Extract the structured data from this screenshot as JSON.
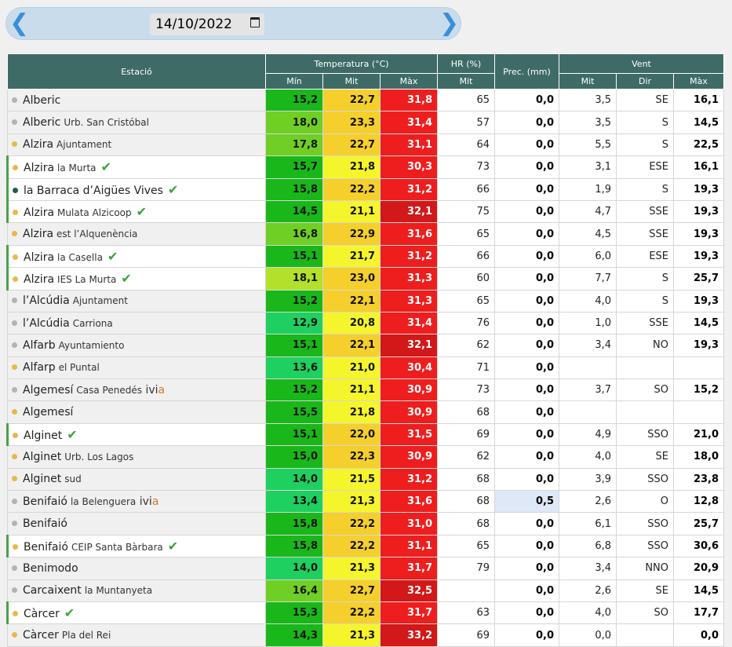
{
  "date": "14/10/2022",
  "header": {
    "estacio": "Estació",
    "temperatura": "Temperatura (°C)",
    "hr": "HR (%)",
    "prec": "Prec. (mm)",
    "vent": "Vent",
    "min": "Mín",
    "mit": "Mit",
    "max": "Màx",
    "hr_mit": "Mit",
    "vent_mit": "Mit",
    "dir": "Dir",
    "vent_max": "Màx"
  },
  "colors": {
    "dot_grey": "#b3b3b3",
    "dot_orange": "#e8b84a",
    "dot_teal": "#1e5b55"
  },
  "rows": [
    {
      "name": "Alberic",
      "sub": "",
      "dot": "grey",
      "check": false,
      "ivia": false,
      "min": "15,2",
      "minc": "#1ab71a",
      "mit": "22,7",
      "mitc": "#f5cf2b",
      "max": "31,8",
      "maxc": "#ee1e1e",
      "hr": "65",
      "prec": "0,0",
      "vmit": "3,5",
      "dir": "SE",
      "vmax": "16,1",
      "white": false
    },
    {
      "name": "Alberic",
      "sub": "Urb. San Cristóbal",
      "dot": "grey",
      "check": false,
      "ivia": false,
      "min": "18,0",
      "minc": "#70cf25",
      "mit": "23,3",
      "mitc": "#f5cf2b",
      "max": "31,4",
      "maxc": "#ee1e1e",
      "hr": "57",
      "prec": "0,0",
      "vmit": "3,5",
      "dir": "S",
      "vmax": "14,5",
      "white": false
    },
    {
      "name": "Alzira",
      "sub": "Ajuntament",
      "dot": "orange",
      "check": false,
      "ivia": false,
      "min": "17,8",
      "minc": "#70cf25",
      "mit": "22,7",
      "mitc": "#f5cf2b",
      "max": "31,1",
      "maxc": "#ee1e1e",
      "hr": "64",
      "prec": "0,0",
      "vmit": "5,5",
      "dir": "S",
      "vmax": "22,5",
      "white": false
    },
    {
      "name": "Alzira",
      "sub": "la Murta",
      "dot": "orange",
      "check": true,
      "ivia": false,
      "min": "15,7",
      "minc": "#1ab71a",
      "mit": "21,8",
      "mitc": "#f5f52b",
      "max": "30,3",
      "maxc": "#ee1e1e",
      "hr": "73",
      "prec": "0,0",
      "vmit": "3,1",
      "dir": "ESE",
      "vmax": "16,1",
      "white": true
    },
    {
      "name": "la Barraca d’Aigües Vives",
      "sub": "",
      "dot": "teal",
      "check": true,
      "ivia": false,
      "min": "15,8",
      "minc": "#1ab71a",
      "mit": "22,2",
      "mitc": "#f5cf2b",
      "max": "31,2",
      "maxc": "#ee1e1e",
      "hr": "66",
      "prec": "0,0",
      "vmit": "1,9",
      "dir": "S",
      "vmax": "19,3",
      "white": true
    },
    {
      "name": "Alzira",
      "sub": "Mulata Alzicoop",
      "dot": "orange",
      "check": true,
      "ivia": false,
      "min": "14,5",
      "minc": "#1ab71a",
      "mit": "21,1",
      "mitc": "#f5f52b",
      "max": "32,1",
      "maxc": "#d21818",
      "hr": "75",
      "prec": "0,0",
      "vmit": "4,7",
      "dir": "SSE",
      "vmax": "19,3",
      "white": true
    },
    {
      "name": "Alzira",
      "sub": "est l’Alquenència",
      "dot": "orange",
      "check": false,
      "ivia": false,
      "min": "16,8",
      "minc": "#70cf25",
      "mit": "22,9",
      "mitc": "#f5cf2b",
      "max": "31,6",
      "maxc": "#ee1e1e",
      "hr": "65",
      "prec": "0,0",
      "vmit": "4,5",
      "dir": "SSE",
      "vmax": "19,3",
      "white": false
    },
    {
      "name": "Alzira",
      "sub": "la Casella",
      "dot": "orange",
      "check": true,
      "ivia": false,
      "min": "15,1",
      "minc": "#1ab71a",
      "mit": "21,7",
      "mitc": "#f5f52b",
      "max": "31,2",
      "maxc": "#ee1e1e",
      "hr": "66",
      "prec": "0,0",
      "vmit": "6,0",
      "dir": "ESE",
      "vmax": "19,3",
      "white": true
    },
    {
      "name": "Alzira",
      "sub": "IES La Murta",
      "dot": "orange",
      "check": true,
      "ivia": false,
      "min": "18,1",
      "minc": "#b2e02b",
      "mit": "23,0",
      "mitc": "#f5cf2b",
      "max": "31,3",
      "maxc": "#ee1e1e",
      "hr": "60",
      "prec": "0,0",
      "vmit": "7,7",
      "dir": "S",
      "vmax": "25,7",
      "white": true
    },
    {
      "name": "l’Alcúdia",
      "sub": "Ajuntament",
      "dot": "grey",
      "check": false,
      "ivia": false,
      "min": "15,2",
      "minc": "#1ab71a",
      "mit": "22,1",
      "mitc": "#f5cf2b",
      "max": "31,3",
      "maxc": "#ee1e1e",
      "hr": "65",
      "prec": "0,0",
      "vmit": "4,0",
      "dir": "S",
      "vmax": "19,3",
      "white": false
    },
    {
      "name": "l’Alcúdia",
      "sub": "Carriona",
      "dot": "grey",
      "check": false,
      "ivia": false,
      "min": "12,9",
      "minc": "#1ed060",
      "mit": "20,8",
      "mitc": "#f5f52b",
      "max": "31,4",
      "maxc": "#ee1e1e",
      "hr": "76",
      "prec": "0,0",
      "vmit": "1,0",
      "dir": "SSE",
      "vmax": "14,5",
      "white": false
    },
    {
      "name": "Alfarb",
      "sub": "Ayuntamiento",
      "dot": "grey",
      "check": false,
      "ivia": false,
      "min": "15,1",
      "minc": "#1ab71a",
      "mit": "22,1",
      "mitc": "#f5cf2b",
      "max": "32,1",
      "maxc": "#d21818",
      "hr": "62",
      "prec": "0,0",
      "vmit": "3,4",
      "dir": "NO",
      "vmax": "19,3",
      "white": false
    },
    {
      "name": "Alfarp",
      "sub": "el Puntal",
      "dot": "orange",
      "check": false,
      "ivia": false,
      "min": "13,6",
      "minc": "#1ed060",
      "mit": "21,0",
      "mitc": "#f5f52b",
      "max": "30,4",
      "maxc": "#ee1e1e",
      "hr": "71",
      "prec": "0,0",
      "vmit": "",
      "dir": "",
      "vmax": "",
      "white": false
    },
    {
      "name": "Algemesí",
      "sub": "Casa Penedés",
      "dot": "grey",
      "check": false,
      "ivia": true,
      "min": "15,2",
      "minc": "#1ab71a",
      "mit": "21,1",
      "mitc": "#f5f52b",
      "max": "30,9",
      "maxc": "#ee1e1e",
      "hr": "73",
      "prec": "0,0",
      "vmit": "3,7",
      "dir": "SO",
      "vmax": "15,2",
      "white": false
    },
    {
      "name": "Algemesí",
      "sub": "",
      "dot": "orange",
      "check": false,
      "ivia": false,
      "min": "15,5",
      "minc": "#1ab71a",
      "mit": "21,8",
      "mitc": "#f5f52b",
      "max": "30,9",
      "maxc": "#ee1e1e",
      "hr": "68",
      "prec": "0,0",
      "vmit": "",
      "dir": "",
      "vmax": "",
      "white": false
    },
    {
      "name": "Alginet",
      "sub": "",
      "dot": "orange",
      "check": true,
      "ivia": false,
      "min": "15,1",
      "minc": "#1ab71a",
      "mit": "22,0",
      "mitc": "#f5cf2b",
      "max": "31,5",
      "maxc": "#ee1e1e",
      "hr": "69",
      "prec": "0,0",
      "vmit": "4,9",
      "dir": "SSO",
      "vmax": "21,0",
      "white": true
    },
    {
      "name": "Alginet",
      "sub": "Urb. Los Lagos",
      "dot": "orange",
      "check": false,
      "ivia": false,
      "min": "15,0",
      "minc": "#1ab71a",
      "mit": "22,3",
      "mitc": "#f5cf2b",
      "max": "30,9",
      "maxc": "#ee1e1e",
      "hr": "62",
      "prec": "0,0",
      "vmit": "4,0",
      "dir": "SE",
      "vmax": "18,0",
      "white": false
    },
    {
      "name": "Alginet",
      "sub": "sud",
      "dot": "orange",
      "check": false,
      "ivia": false,
      "min": "14,0",
      "minc": "#1ed060",
      "mit": "21,5",
      "mitc": "#f5f52b",
      "max": "31,2",
      "maxc": "#ee1e1e",
      "hr": "68",
      "prec": "0,0",
      "vmit": "3,9",
      "dir": "SSO",
      "vmax": "23,8",
      "white": false
    },
    {
      "name": "Benifaió",
      "sub": "la Belenguera",
      "dot": "grey",
      "check": false,
      "ivia": true,
      "min": "13,4",
      "minc": "#1ed060",
      "mit": "21,3",
      "mitc": "#f5f52b",
      "max": "31,6",
      "maxc": "#ee1e1e",
      "hr": "68",
      "prec": "0,5",
      "vmit": "2,6",
      "dir": "O",
      "vmax": "12,8",
      "white": false
    },
    {
      "name": "Benifaió",
      "sub": "",
      "dot": "grey",
      "check": false,
      "ivia": false,
      "min": "15,8",
      "minc": "#1ab71a",
      "mit": "22,2",
      "mitc": "#f5cf2b",
      "max": "31,0",
      "maxc": "#ee1e1e",
      "hr": "68",
      "prec": "0,0",
      "vmit": "6,1",
      "dir": "SSO",
      "vmax": "25,7",
      "white": false
    },
    {
      "name": "Benifaió",
      "sub": "CEIP Santa Bàrbara",
      "dot": "orange",
      "check": true,
      "ivia": false,
      "min": "15,8",
      "minc": "#1ab71a",
      "mit": "22,2",
      "mitc": "#f5cf2b",
      "max": "31,1",
      "maxc": "#ee1e1e",
      "hr": "65",
      "prec": "0,0",
      "vmit": "6,8",
      "dir": "SSO",
      "vmax": "30,6",
      "white": true
    },
    {
      "name": "Benimodo",
      "sub": "",
      "dot": "grey",
      "check": false,
      "ivia": false,
      "min": "14,0",
      "minc": "#1ed060",
      "mit": "21,3",
      "mitc": "#f5f52b",
      "max": "31,7",
      "maxc": "#ee1e1e",
      "hr": "79",
      "prec": "0,0",
      "vmit": "3,4",
      "dir": "NNO",
      "vmax": "20,9",
      "white": false
    },
    {
      "name": "Carcaixent",
      "sub": "la Muntanyeta",
      "dot": "grey",
      "check": false,
      "ivia": false,
      "min": "16,4",
      "minc": "#70cf25",
      "mit": "22,7",
      "mitc": "#f5cf2b",
      "max": "32,5",
      "maxc": "#d21818",
      "hr": "",
      "prec": "0,0",
      "vmit": "2,6",
      "dir": "SE",
      "vmax": "14,5",
      "white": false
    },
    {
      "name": "Càrcer",
      "sub": "",
      "dot": "orange",
      "check": true,
      "ivia": false,
      "min": "15,3",
      "minc": "#1ab71a",
      "mit": "22,2",
      "mitc": "#f5cf2b",
      "max": "31,7",
      "maxc": "#ee1e1e",
      "hr": "63",
      "prec": "0,0",
      "vmit": "4,0",
      "dir": "SO",
      "vmax": "17,7",
      "white": true
    },
    {
      "name": "Càrcer",
      "sub": "Pla del Rei",
      "dot": "orange",
      "check": false,
      "ivia": false,
      "min": "14,3",
      "minc": "#1ab71a",
      "mit": "21,3",
      "mitc": "#f5f52b",
      "max": "33,2",
      "maxc": "#d21818",
      "hr": "69",
      "prec": "0,0",
      "vmit": "0,0",
      "dir": "",
      "vmax": "0,0",
      "white": false
    }
  ]
}
